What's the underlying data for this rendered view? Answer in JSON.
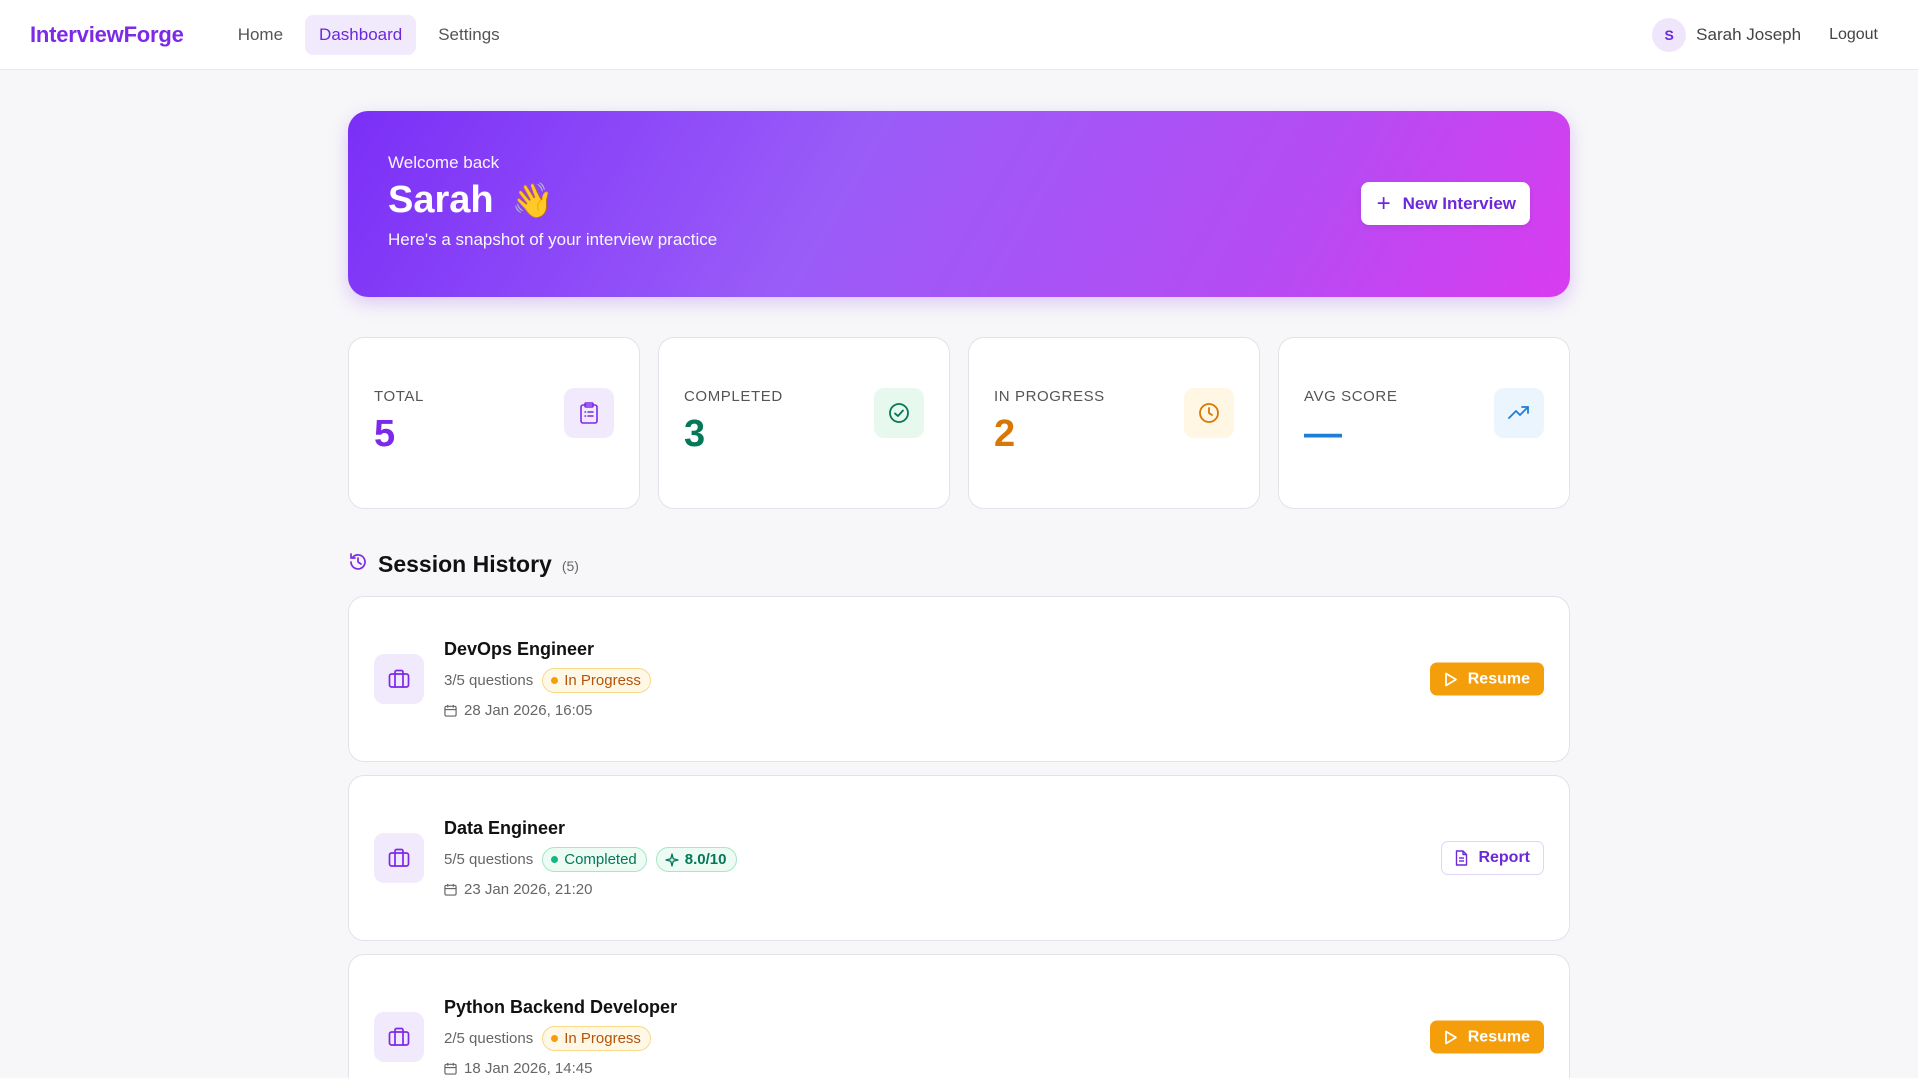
{
  "nav": {
    "brand": "InterviewForge",
    "links": [
      {
        "label": "Home"
      },
      {
        "label": "Dashboard"
      },
      {
        "label": "Settings"
      }
    ],
    "user_initial": "S",
    "user_name": "Sarah Joseph",
    "logout_label": "Logout"
  },
  "hero": {
    "welcome": "Welcome back",
    "name": "Sarah",
    "wave_emoji": "👋",
    "subtitle": "Here's a snapshot of your interview practice",
    "new_button_icon": "+",
    "new_button": "New Interview"
  },
  "stats": [
    {
      "label": "TOTAL",
      "value": "5",
      "color": "#7c2ae8",
      "icon": "clipboard-icon"
    },
    {
      "label": "COMPLETED",
      "value": "3",
      "color": "#047857",
      "icon": "check-circle-icon"
    },
    {
      "label": "IN PROGRESS",
      "value": "2",
      "color": "#d97706",
      "icon": "clock-icon"
    },
    {
      "label": "AVG SCORE",
      "value": "—",
      "color": "#1d7fd6",
      "icon": "trending-up-icon"
    }
  ],
  "history": {
    "title": "Session History",
    "count": "(5)",
    "sessions": [
      {
        "title": "DevOps Engineer",
        "questions": "3/5 questions",
        "status": "In Progress",
        "date": "28 Jan 2026, 16:05",
        "action": "Resume"
      },
      {
        "title": "Data Engineer",
        "questions": "5/5 questions",
        "status": "Completed",
        "score": "8.0/10",
        "date": "23 Jan 2026, 21:20",
        "action": "Report"
      },
      {
        "title": "Python Backend Developer",
        "questions": "2/5 questions",
        "status": "In Progress",
        "date": "18 Jan 2026, 14:45",
        "action": "Resume"
      }
    ]
  },
  "colors": {
    "brand": "#7c2ae8",
    "hero_gradient_start": "#7b2ff7",
    "hero_gradient_end": "#d93cf0",
    "resume": "#f59e0b"
  }
}
